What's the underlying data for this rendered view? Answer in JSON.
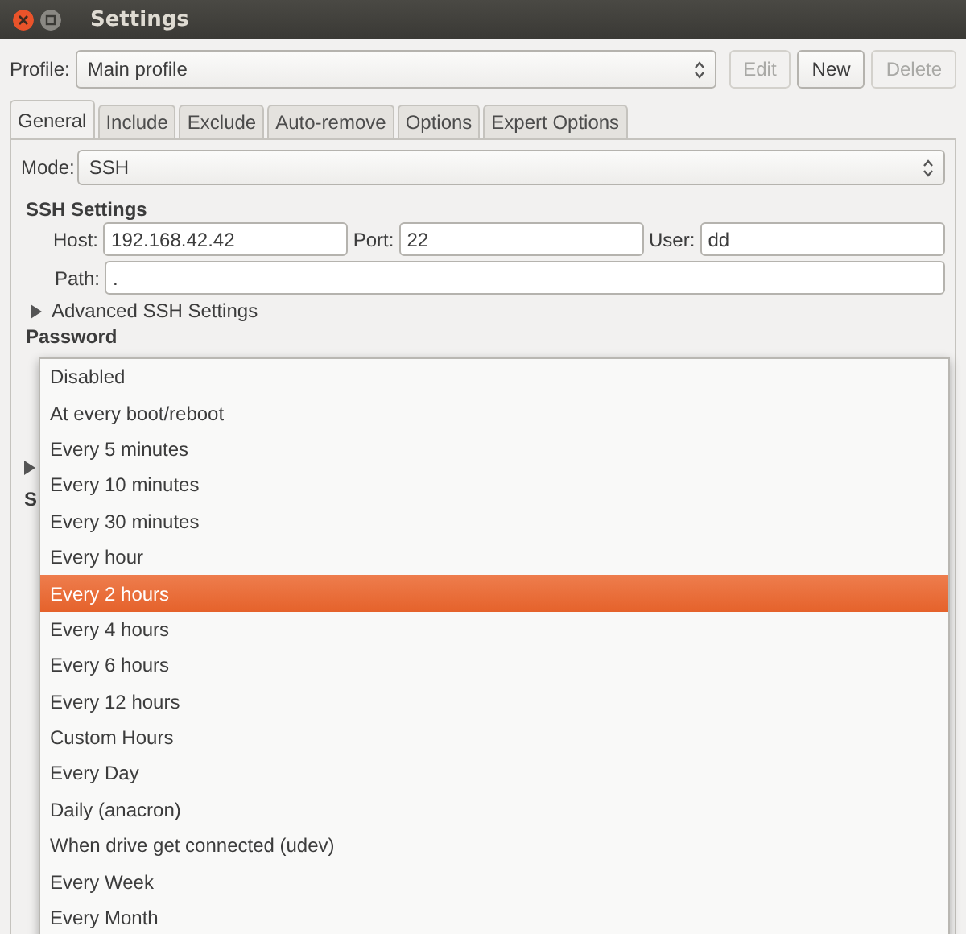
{
  "window": {
    "title": "Settings"
  },
  "profile": {
    "label": "Profile:",
    "value": "Main profile",
    "buttons": [
      {
        "label": "Edit",
        "disabled": true
      },
      {
        "label": "New",
        "disabled": false
      },
      {
        "label": "Delete",
        "disabled": true
      }
    ]
  },
  "tabs": [
    {
      "label": "General",
      "selected": true
    },
    {
      "label": "Include",
      "selected": false
    },
    {
      "label": "Exclude",
      "selected": false
    },
    {
      "label": "Auto-remove",
      "selected": false
    },
    {
      "label": "Options",
      "selected": false
    },
    {
      "label": "Expert Options",
      "selected": false
    }
  ],
  "mode": {
    "label": "Mode:",
    "value": "SSH"
  },
  "ssh_settings": {
    "title": "SSH Settings",
    "host_label": "Host:",
    "host": "192.168.42.42",
    "port_label": "Port:",
    "port": "22",
    "user_label": "User:",
    "user": "dd",
    "path_label": "Path:",
    "path": ".",
    "advanced": {
      "label": "Advanced SSH Settings",
      "expanded": false
    }
  },
  "password": {
    "title": "Password"
  },
  "hidden_section": {
    "title": "S"
  },
  "schedule_dropdown": {
    "items": [
      {
        "label": "Disabled",
        "selected": false
      },
      {
        "label": "At every boot/reboot",
        "selected": false
      },
      {
        "label": "Every 5 minutes",
        "selected": false
      },
      {
        "label": "Every 10 minutes",
        "selected": false
      },
      {
        "label": "Every 30 minutes",
        "selected": false
      },
      {
        "label": "Every hour",
        "selected": false
      },
      {
        "label": "Every 2 hours",
        "selected": true
      },
      {
        "label": "Every 4 hours",
        "selected": false
      },
      {
        "label": "Every 6 hours",
        "selected": false
      },
      {
        "label": "Every 12 hours",
        "selected": false
      },
      {
        "label": "Custom Hours",
        "selected": false
      },
      {
        "label": "Every Day",
        "selected": false
      },
      {
        "label": "Daily (anacron)",
        "selected": false
      },
      {
        "label": "When drive get connected (udev)",
        "selected": false
      },
      {
        "label": "Every Week",
        "selected": false
      },
      {
        "label": "Every Month",
        "selected": false
      }
    ]
  }
}
